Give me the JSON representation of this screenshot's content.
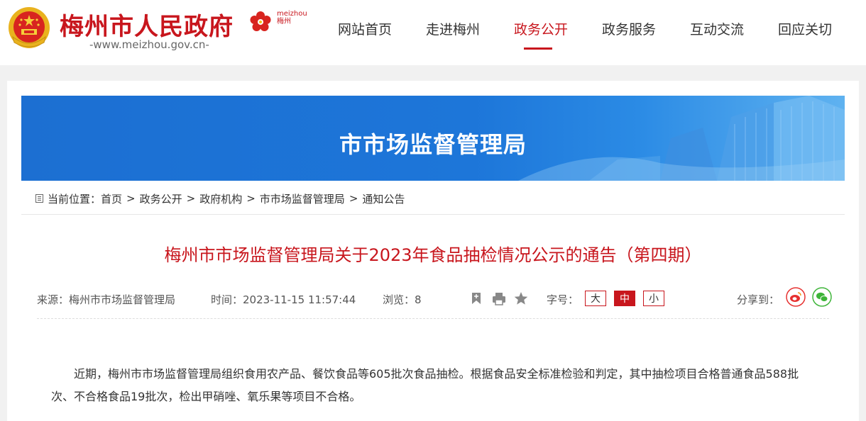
{
  "header": {
    "site_title": "梅州市人民政府",
    "site_url": "-www.meizhou.gov.cn-",
    "logo_mini_en": "meizhou",
    "logo_mini_cn": "梅州"
  },
  "nav": {
    "items": [
      {
        "label": "网站首页",
        "active": false
      },
      {
        "label": "走进梅州",
        "active": false
      },
      {
        "label": "政务公开",
        "active": true
      },
      {
        "label": "政务服务",
        "active": false
      },
      {
        "label": "互动交流",
        "active": false
      },
      {
        "label": "回应关切",
        "active": false
      }
    ]
  },
  "banner": {
    "title": "市市场监督管理局"
  },
  "breadcrumb": {
    "prefix": "当前位置：",
    "items": [
      "首页",
      "政务公开",
      "政府机构",
      "市市场监督管理局",
      "通知公告"
    ],
    "separator": ">"
  },
  "article": {
    "title": "梅州市市场监督管理局关于2023年食品抽检情况公示的通告（第四期）",
    "source": "来源：梅州市市场监督管理局",
    "time": "时间：2023-11-15 11:57:44",
    "views": "浏览：8",
    "font_size_label": "字号：",
    "font_sizes": [
      "大",
      "中",
      "小"
    ],
    "share_label": "分享到：",
    "body": "近期，梅州市市场监督管理局组织食用农产品、餐饮食品等605批次食品抽检。根据食品安全标准检验和判定，其中抽检项目合格普通食品588批次、不合格食品19批次，检出甲硝唑、氧乐果等项目不合格。"
  },
  "colors": {
    "brand_red": "#c8161d",
    "banner_blue": "#1d76d9"
  },
  "icons": [
    "national-emblem-icon",
    "meizhou-flower-icon",
    "breadcrumb-icon",
    "bookmark-icon",
    "print-icon",
    "star-icon",
    "weibo-icon",
    "wechat-icon"
  ]
}
